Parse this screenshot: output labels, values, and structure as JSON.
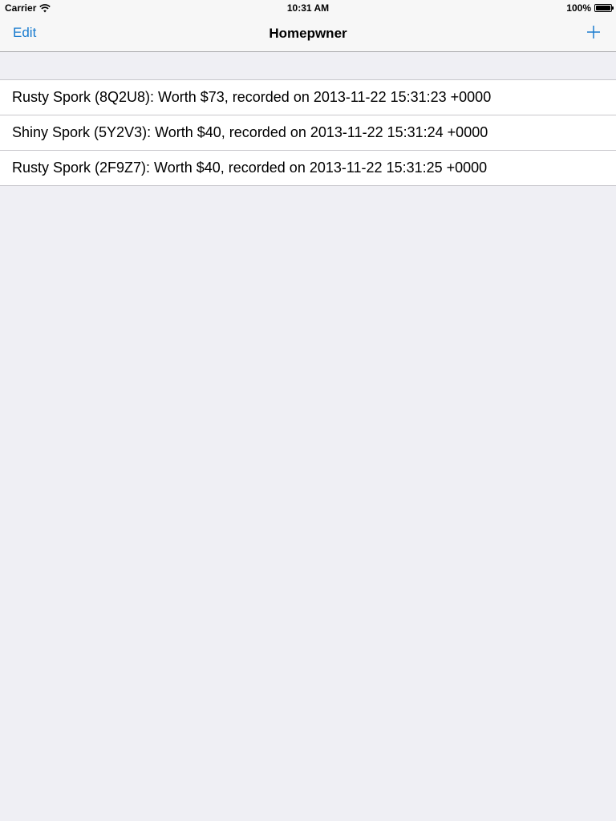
{
  "status_bar": {
    "carrier": "Carrier",
    "time": "10:31 AM",
    "battery": "100%"
  },
  "nav_bar": {
    "left_button": "Edit",
    "title": "Homepwner",
    "right_icon": "plus-icon"
  },
  "items": [
    {
      "label": "Rusty Spork (8Q2U8): Worth $73, recorded on 2013-11-22 15:31:23 +0000"
    },
    {
      "label": "Shiny Spork (5Y2V3): Worth $40, recorded on 2013-11-22 15:31:24 +0000"
    },
    {
      "label": "Rusty Spork (2F9Z7): Worth $40, recorded on 2013-11-22 15:31:25 +0000"
    }
  ],
  "colors": {
    "tint": "#1a7ccf",
    "background": "#efeff4",
    "separator": "#c8c7cc"
  }
}
